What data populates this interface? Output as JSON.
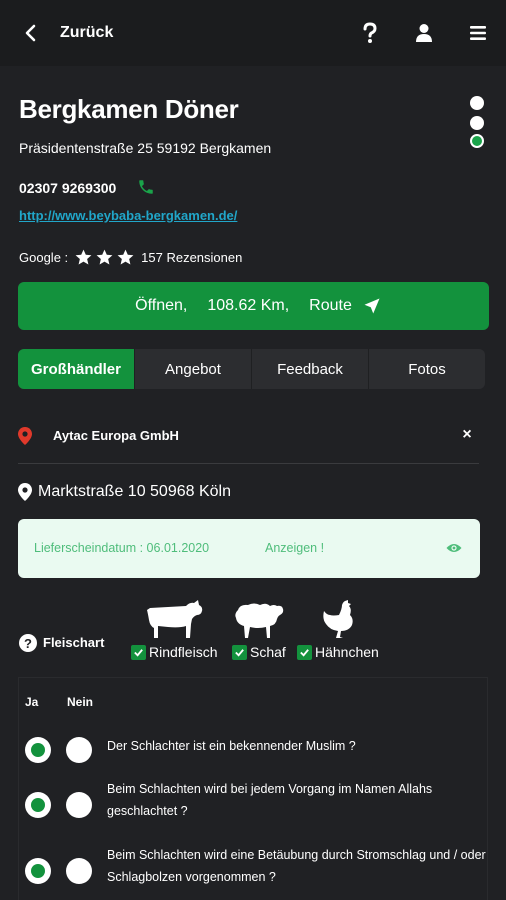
{
  "header": {
    "back_label": "Zurück",
    "icons": [
      "chevron-left-icon",
      "question-icon",
      "user-icon",
      "menu-icon"
    ]
  },
  "restaurant": {
    "name": "Bergkamen Döner",
    "address": "Präsidentenstraße 25 59192 Bergkamen",
    "phone": "02307 9269300",
    "website": "http://www.beybaba-bergkamen.de/",
    "google_prefix": "Google :",
    "rating_stars": 3,
    "reviews": "157 Rezensionen",
    "status_lights": [
      "white",
      "white",
      "green"
    ]
  },
  "route_button": {
    "open": "Öffnen,",
    "distance": "108.62 Km,",
    "route": "Route"
  },
  "tabs": [
    {
      "label": "Großhändler",
      "active": true
    },
    {
      "label": "Angebot",
      "active": false
    },
    {
      "label": "Feedback",
      "active": false
    },
    {
      "label": "Fotos",
      "active": false
    }
  ],
  "supplier": {
    "name": "Aytac Europa GmbH",
    "address": "Marktstraße 10 50968 Köln",
    "close_label": "×"
  },
  "notice": {
    "text": "Lieferscheindatum : 06.01.2020",
    "show_label": "Anzeigen !"
  },
  "meat": {
    "help_label": "?",
    "label": "Fleischart",
    "options": [
      {
        "label": "Rindfleisch",
        "checked": true
      },
      {
        "label": "Schaf",
        "checked": true
      },
      {
        "label": "Hähnchen",
        "checked": true
      }
    ]
  },
  "questions": {
    "yes_header": "Ja",
    "no_header": "Nein",
    "items": [
      {
        "text": "Der Schlachter ist ein bekennender Muslim ?",
        "answer": "yes"
      },
      {
        "text": "Beim Schlachten wird bei jedem Vorgang im Namen Allahs geschlachtet ?",
        "answer": "yes"
      },
      {
        "text": "Beim Schlachten wird eine Betäubung durch Stromschlag und / oder Schlagbolzen vorgenommen ?",
        "answer": "yes"
      }
    ]
  },
  "colors": {
    "accent_green": "#13923d",
    "link_blue": "#21a6c9",
    "pin_red": "#e0392b",
    "background": "#202124"
  }
}
